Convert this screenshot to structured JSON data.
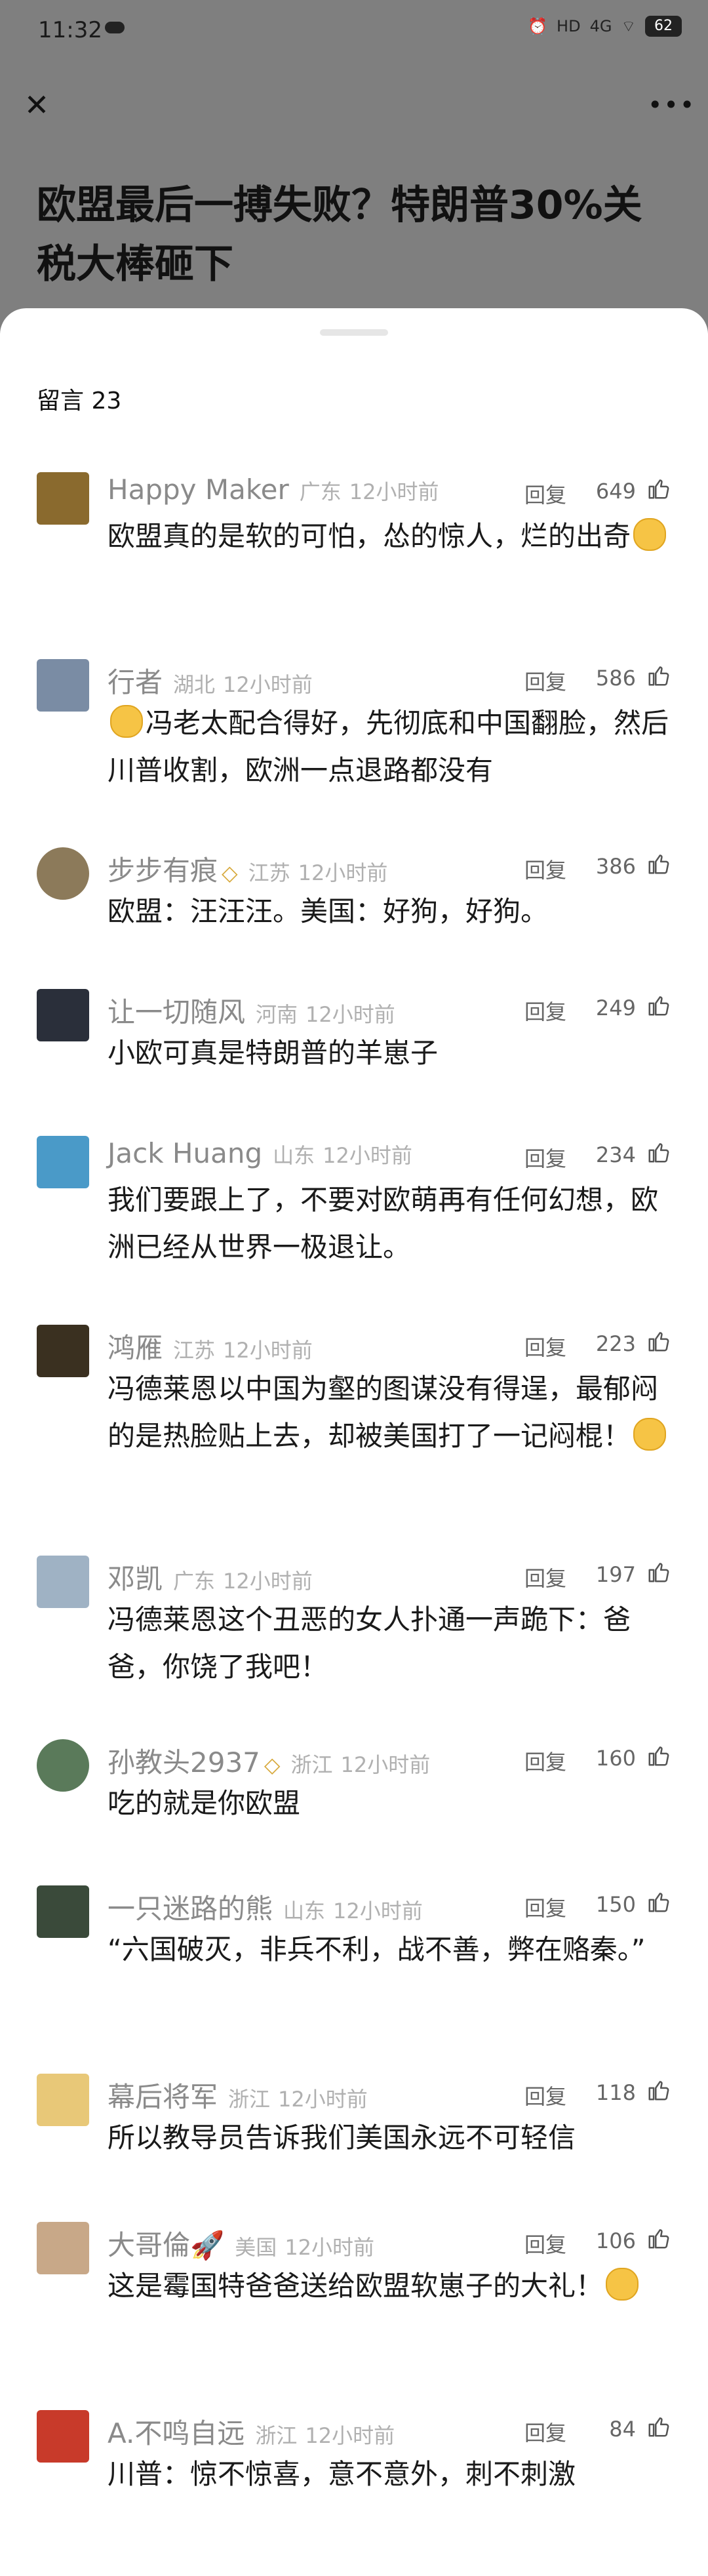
{
  "status_bar": {
    "time": "11:32",
    "net_label": "4G",
    "hd_label": "HD",
    "battery": "62"
  },
  "article": {
    "title": "欧盟最后一搏失败？特朗普30%关税大棒砸下"
  },
  "comments_header": {
    "label": "留言 23"
  },
  "reply_label": "回复",
  "comments": [
    {
      "user": "Happy Maker",
      "location": "广东",
      "time": "12小时前",
      "likes": "649",
      "text": "欧盟真的是软的可怕，怂的惊人，烂的出奇",
      "emoji_after": true,
      "emoji_before": false,
      "avatar_color": "#8a6a2e"
    },
    {
      "user": "行者",
      "location": "湖北",
      "time": "12小时前",
      "likes": "586",
      "text": "冯老太配合得好，先彻底和中国翻脸，然后川普收割，欧洲一点退路都没有",
      "emoji_after": false,
      "emoji_before": true,
      "avatar_color": "#7a8ca4"
    },
    {
      "user": "步步有痕",
      "location": "江苏",
      "time": "12小时前",
      "likes": "386",
      "text": "欧盟：汪汪汪。美国：好狗，好狗。",
      "emoji_after": false,
      "emoji_before": false,
      "avatar_color": "#8c7a5a",
      "badge": true
    },
    {
      "user": "让一切随风",
      "location": "河南",
      "time": "12小时前",
      "likes": "249",
      "text": "小欧可真是特朗普的羊崽子",
      "emoji_after": false,
      "emoji_before": false,
      "avatar_color": "#2a2f3a"
    },
    {
      "user": "Jack Huang",
      "location": "山东",
      "time": "12小时前",
      "likes": "234",
      "text": "我们要跟上了，不要对欧萌再有任何幻想，欧洲已经从世界一极退让。",
      "emoji_after": false,
      "emoji_before": false,
      "avatar_color": "#4a9ac8"
    },
    {
      "user": "鸿雁",
      "location": "江苏",
      "time": "12小时前",
      "likes": "223",
      "text": "冯德莱恩以中国为壑的图谋没有得逞，最郁闷的是热脸贴上去，却被美国打了一记闷棍！",
      "emoji_after": true,
      "emoji_before": false,
      "avatar_color": "#3a3020"
    },
    {
      "user": "邓凯",
      "location": "广东",
      "time": "12小时前",
      "likes": "197",
      "text": "冯德莱恩这个丑恶的女人扑通一声跪下：爸爸，你饶了我吧！",
      "emoji_after": false,
      "emoji_before": false,
      "avatar_color": "#9fb2c4"
    },
    {
      "user": "孙教头2937",
      "location": "浙江",
      "time": "12小时前",
      "likes": "160",
      "text": "吃的就是你欧盟",
      "emoji_after": false,
      "emoji_before": false,
      "avatar_color": "#5a7a5a",
      "badge": true
    },
    {
      "user": "一只迷路的熊",
      "location": "山东",
      "time": "12小时前",
      "likes": "150",
      "text": "“六国破灭，非兵不利，战不善，弊在赂秦。”",
      "emoji_after": false,
      "emoji_before": false,
      "avatar_color": "#3a4a3a"
    },
    {
      "user": "幕后将军",
      "location": "浙江",
      "time": "12小时前",
      "likes": "118",
      "text": "所以教导员告诉我们美国永远不可轻信",
      "emoji_after": false,
      "emoji_before": false,
      "avatar_color": "#e8c878"
    },
    {
      "user": "大哥倫🚀",
      "location": "美国",
      "time": "12小时前",
      "likes": "106",
      "text": "这是霉国特爸爸送给欧盟软崽子的大礼！",
      "emoji_after": true,
      "emoji_before": false,
      "avatar_color": "#c8a888"
    },
    {
      "user": "A.不鸣自远",
      "location": "浙江",
      "time": "12小时前",
      "likes": "84",
      "text": "川普：惊不惊喜，意不意外，刺不刺激",
      "emoji_after": false,
      "emoji_before": false,
      "avatar_color": "#c83a2a"
    }
  ]
}
